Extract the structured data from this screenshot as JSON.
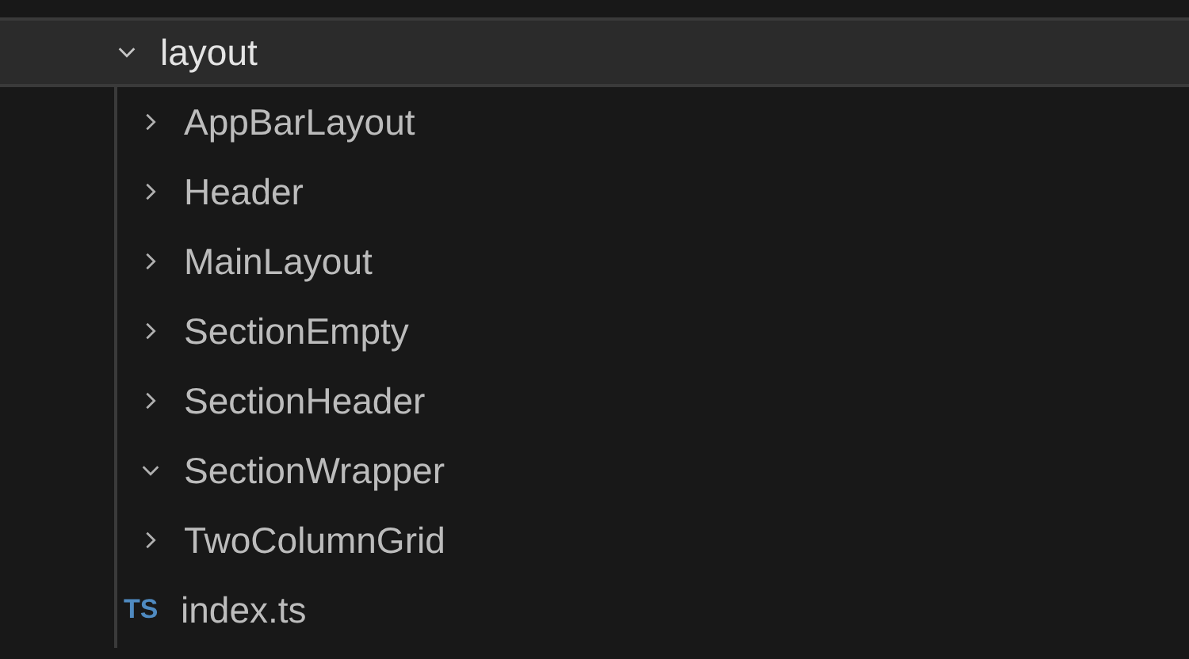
{
  "tree": {
    "name": "layout",
    "expanded": true,
    "selected": true,
    "children": [
      {
        "kind": "folder",
        "name": "AppBarLayout",
        "expanded": false
      },
      {
        "kind": "folder",
        "name": "Header",
        "expanded": false
      },
      {
        "kind": "folder",
        "name": "MainLayout",
        "expanded": false
      },
      {
        "kind": "folder",
        "name": "SectionEmpty",
        "expanded": false
      },
      {
        "kind": "folder",
        "name": "SectionHeader",
        "expanded": false
      },
      {
        "kind": "folder",
        "name": "SectionWrapper",
        "expanded": true
      },
      {
        "kind": "folder",
        "name": "TwoColumnGrid",
        "expanded": false
      },
      {
        "kind": "file",
        "name": "index.ts",
        "badge": "TS"
      }
    ]
  }
}
